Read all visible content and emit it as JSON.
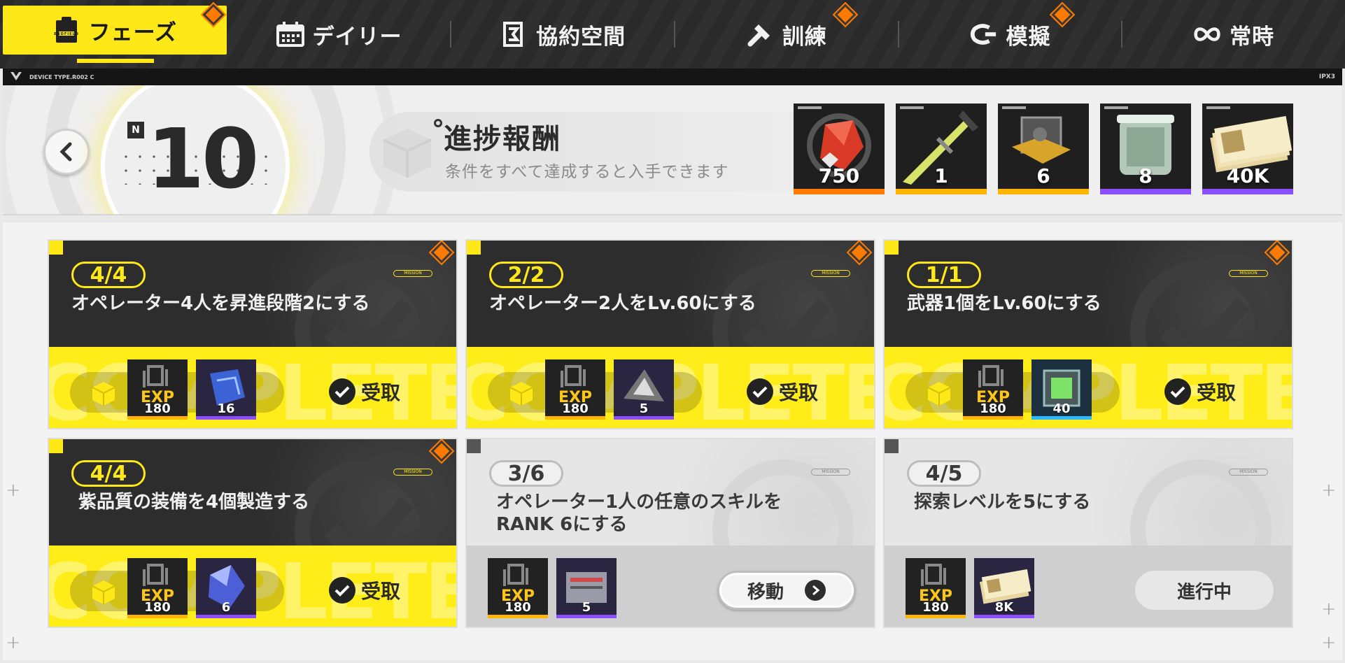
{
  "nav": {
    "tabs": [
      {
        "label": "フェーズ",
        "icon": "clipboard-icon",
        "active": true,
        "badge": true
      },
      {
        "label": "デイリー",
        "icon": "calendar-icon",
        "active": false,
        "badge": false
      },
      {
        "label": "協約空間",
        "icon": "contract-icon",
        "active": false,
        "badge": false
      },
      {
        "label": "訓練",
        "icon": "hammer-icon",
        "active": false,
        "badge": true
      },
      {
        "label": "模擬",
        "icon": "simulation-icon",
        "active": false,
        "badge": true
      },
      {
        "label": "常時",
        "icon": "infinity-icon",
        "active": false,
        "badge": false
      }
    ],
    "active_badge_text": "ENDFIELD"
  },
  "device_strip": {
    "device_type": "DEVICE TYPE.R002 C",
    "model": "IPX3"
  },
  "header": {
    "level_badge": "N",
    "level": "10",
    "title": "進捗報酬",
    "subtitle": "条件をすべて達成すると入手できます",
    "rewards": [
      {
        "name": "origeometry-crystal-icon",
        "amount": "750",
        "rarity_color": "#ff7a00"
      },
      {
        "name": "sword-icon",
        "amount": "1",
        "rarity_color": "#ffb400"
      },
      {
        "name": "gear-part-icon",
        "amount": "6",
        "rarity_color": "#ffb400"
      },
      {
        "name": "capsule-icon",
        "amount": "8",
        "rarity_color": "#8c4dff"
      },
      {
        "name": "credit-bills-icon",
        "amount": "40K",
        "rarity_color": "#8c4dff"
      }
    ]
  },
  "missions": [
    {
      "count": "4/4",
      "desc": "オペレーター4人を昇進段階2にする",
      "status": "done",
      "status_label": "受取",
      "rewards": [
        {
          "type": "exp",
          "label": "180",
          "exp_text": "EXP"
        },
        {
          "type": "item",
          "label": "16",
          "rarity": "purple"
        }
      ]
    },
    {
      "count": "2/2",
      "desc": "オペレーター2人をLv.60にする",
      "status": "done",
      "status_label": "受取",
      "rewards": [
        {
          "type": "exp",
          "label": "180",
          "exp_text": "EXP"
        },
        {
          "type": "item",
          "label": "5",
          "rarity": "purple"
        }
      ]
    },
    {
      "count": "1/1",
      "desc": "武器1個をLv.60にする",
      "status": "done",
      "status_label": "受取",
      "rewards": [
        {
          "type": "exp",
          "label": "180",
          "exp_text": "EXP"
        },
        {
          "type": "item",
          "label": "40",
          "rarity": "blue"
        }
      ]
    },
    {
      "count": "4/4",
      "desc": "紫品質の装備を4個製造する",
      "status": "done",
      "status_label": "受取",
      "rewards": [
        {
          "type": "exp",
          "label": "180",
          "exp_text": "EXP"
        },
        {
          "type": "item",
          "label": "6",
          "rarity": "purple"
        }
      ]
    },
    {
      "count": "3/6",
      "desc": "オペレーター1人の任意のスキルをRANK 6にする",
      "status": "move",
      "status_label": "移動",
      "rewards": [
        {
          "type": "exp",
          "label": "180",
          "exp_text": "EXP"
        },
        {
          "type": "item",
          "label": "5",
          "rarity": "purple"
        }
      ]
    },
    {
      "count": "4/5",
      "desc": "探索レベルを5にする",
      "status": "progress",
      "status_label": "進行中",
      "rewards": [
        {
          "type": "exp",
          "label": "180",
          "exp_text": "EXP"
        },
        {
          "type": "item",
          "label": "8K",
          "rarity": "purple"
        }
      ]
    }
  ],
  "mission_tag": "MISSION",
  "watermark": "COMPLETE",
  "colors": {
    "accent_yellow": "#ffe817",
    "orange": "#ff7a00",
    "purple": "#8c4dff",
    "gold": "#ffb400",
    "blue": "#2db9ff"
  }
}
